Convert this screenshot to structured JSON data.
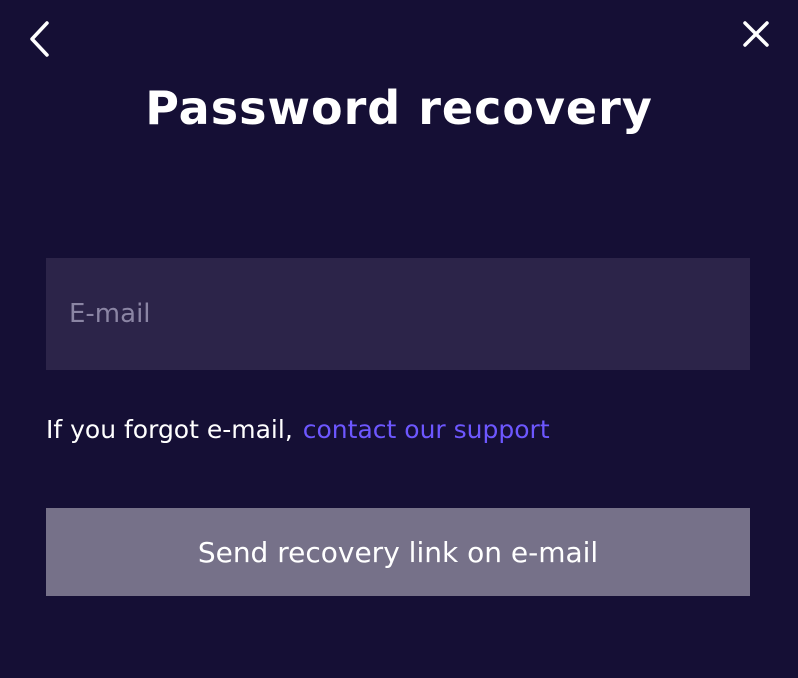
{
  "header": {
    "back_icon": "chevron-left-icon",
    "close_icon": "close-icon",
    "title": "Password recovery"
  },
  "form": {
    "email_placeholder": "E-mail",
    "email_value": "",
    "help_text": "If you forgot e-mail,",
    "support_link_label": "contact our support",
    "submit_label": "Send recovery link on e-mail"
  },
  "colors": {
    "background": "#150f35",
    "input_background": "#2c2449",
    "link": "#6d57ff",
    "button_disabled": "#767189",
    "text": "#ffffff"
  }
}
